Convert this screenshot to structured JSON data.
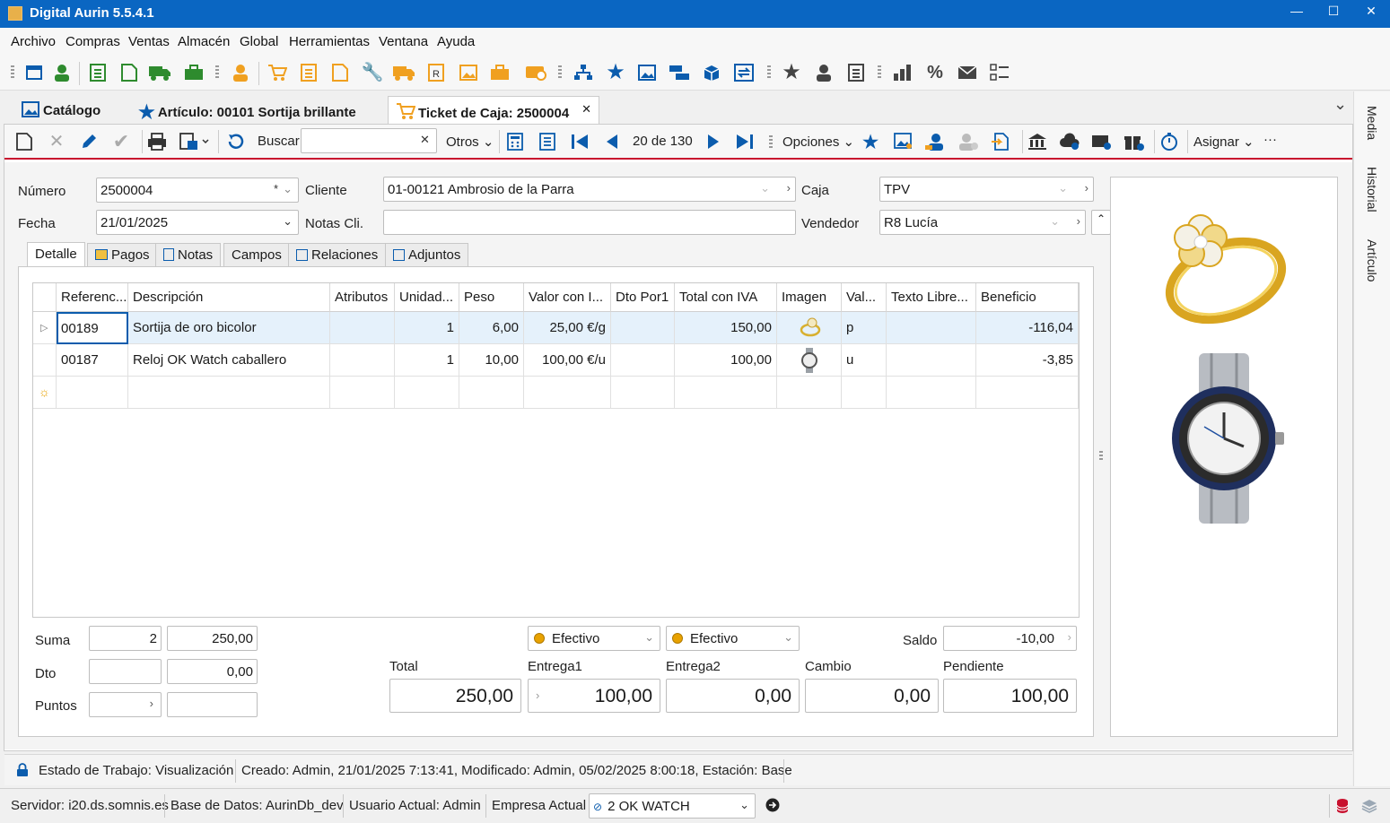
{
  "window": {
    "title": "Digital Aurin 5.5.4.1",
    "minimize": "—",
    "maximize": "☐",
    "close": "✕"
  },
  "menu": [
    "Archivo",
    "Compras",
    "Ventas",
    "Almacén",
    "Global",
    "Herramientas",
    "Ventana",
    "Ayuda"
  ],
  "doc_tabs": {
    "catalog": "Catálogo",
    "article": "Artículo: 00101 Sortija brillante",
    "ticket": "Ticket de Caja: 2500004",
    "ticket_close": "✕",
    "overflow": "⌄"
  },
  "side_panel": [
    "Media",
    "Historial",
    "Artículo"
  ],
  "doc_toolbar": {
    "search_label": "Buscar",
    "search_value": "",
    "search_clear": "✕",
    "others": "Otros ⌄",
    "record_position": "20 de 130",
    "options": "Opciones ⌄",
    "assign": "Asignar ⌄",
    "more": "···"
  },
  "form": {
    "numero_label": "Número",
    "numero_value": "2500004",
    "numero_marker": "*",
    "fecha_label": "Fecha",
    "fecha_value": "21/01/2025",
    "cliente_label": "Cliente",
    "cliente_value": "01-00121  Ambrosio de la Parra",
    "notas_label": "Notas Cli.",
    "notas_value": "",
    "caja_label": "Caja",
    "caja_value": "TPV",
    "vendedor_label": "Vendedor",
    "vendedor_value": "R8  Lucía"
  },
  "sub_tabs": [
    "Detalle",
    "Pagos",
    "Notas",
    "Campos",
    "Relaciones",
    "Adjuntos"
  ],
  "grid": {
    "columns": [
      "Referenc...",
      "Descripción",
      "Atributos",
      "Unidad...",
      "Peso",
      "Valor con I...",
      "Dto Por1",
      "Total con IVA",
      "Imagen",
      "Val...",
      "Texto Libre...",
      "Beneficio"
    ],
    "rows": [
      {
        "ref": "00189",
        "desc": "Sortija de oro bicolor",
        "attr": "",
        "units": "1",
        "weight": "6,00",
        "value": "25,00 €/g",
        "dto": "",
        "total": "150,00",
        "image": "ring",
        "val": "p",
        "free_text": "",
        "profit": "-116,04"
      },
      {
        "ref": "00187",
        "desc": "Reloj OK Watch caballero",
        "attr": "",
        "units": "1",
        "weight": "10,00",
        "value": "100,00 €/u",
        "dto": "",
        "total": "100,00",
        "image": "watch",
        "val": "u",
        "free_text": "",
        "profit": "-3,85"
      }
    ],
    "new_row_marker": "☼",
    "current_row_marker": "▷"
  },
  "totals": {
    "suma_label": "Suma",
    "suma_qty": "2",
    "suma_amount": "250,00",
    "dto_label": "Dto",
    "dto_qty": "",
    "dto_amount": "0,00",
    "puntos_label": "Puntos",
    "puntos_qty": "",
    "puntos_amount": "",
    "payment1": "Efectivo",
    "payment2": "Efectivo",
    "saldo_label": "Saldo",
    "saldo_value": "-10,00",
    "total_label": "Total",
    "total_value": "250,00",
    "entrega1_label": "Entrega1",
    "entrega1_value": "100,00",
    "entrega2_label": "Entrega2",
    "entrega2_value": "0,00",
    "cambio_label": "Cambio",
    "cambio_value": "0,00",
    "pendiente_label": "Pendiente",
    "pendiente_value": "100,00"
  },
  "status": {
    "work_state": "Estado de Trabajo: Visualización",
    "audit": "Creado: Admin, 21/01/2025 7:13:41, Modificado: Admin, 05/02/2025 8:00:18, Estación: Base",
    "server": "Servidor: i20.ds.somnis.es",
    "database": "Base de Datos: AurinDb_dev",
    "user": "Usuario Actual: Admin",
    "company_label": "Empresa Actual",
    "company_value": "2  OK WATCH"
  },
  "colors": {
    "titlebar": "#0a66c2",
    "accent_red": "#c8102e",
    "icon_green": "#2e8b2e",
    "icon_orange": "#f0a020",
    "icon_blue": "#0b5cad"
  }
}
